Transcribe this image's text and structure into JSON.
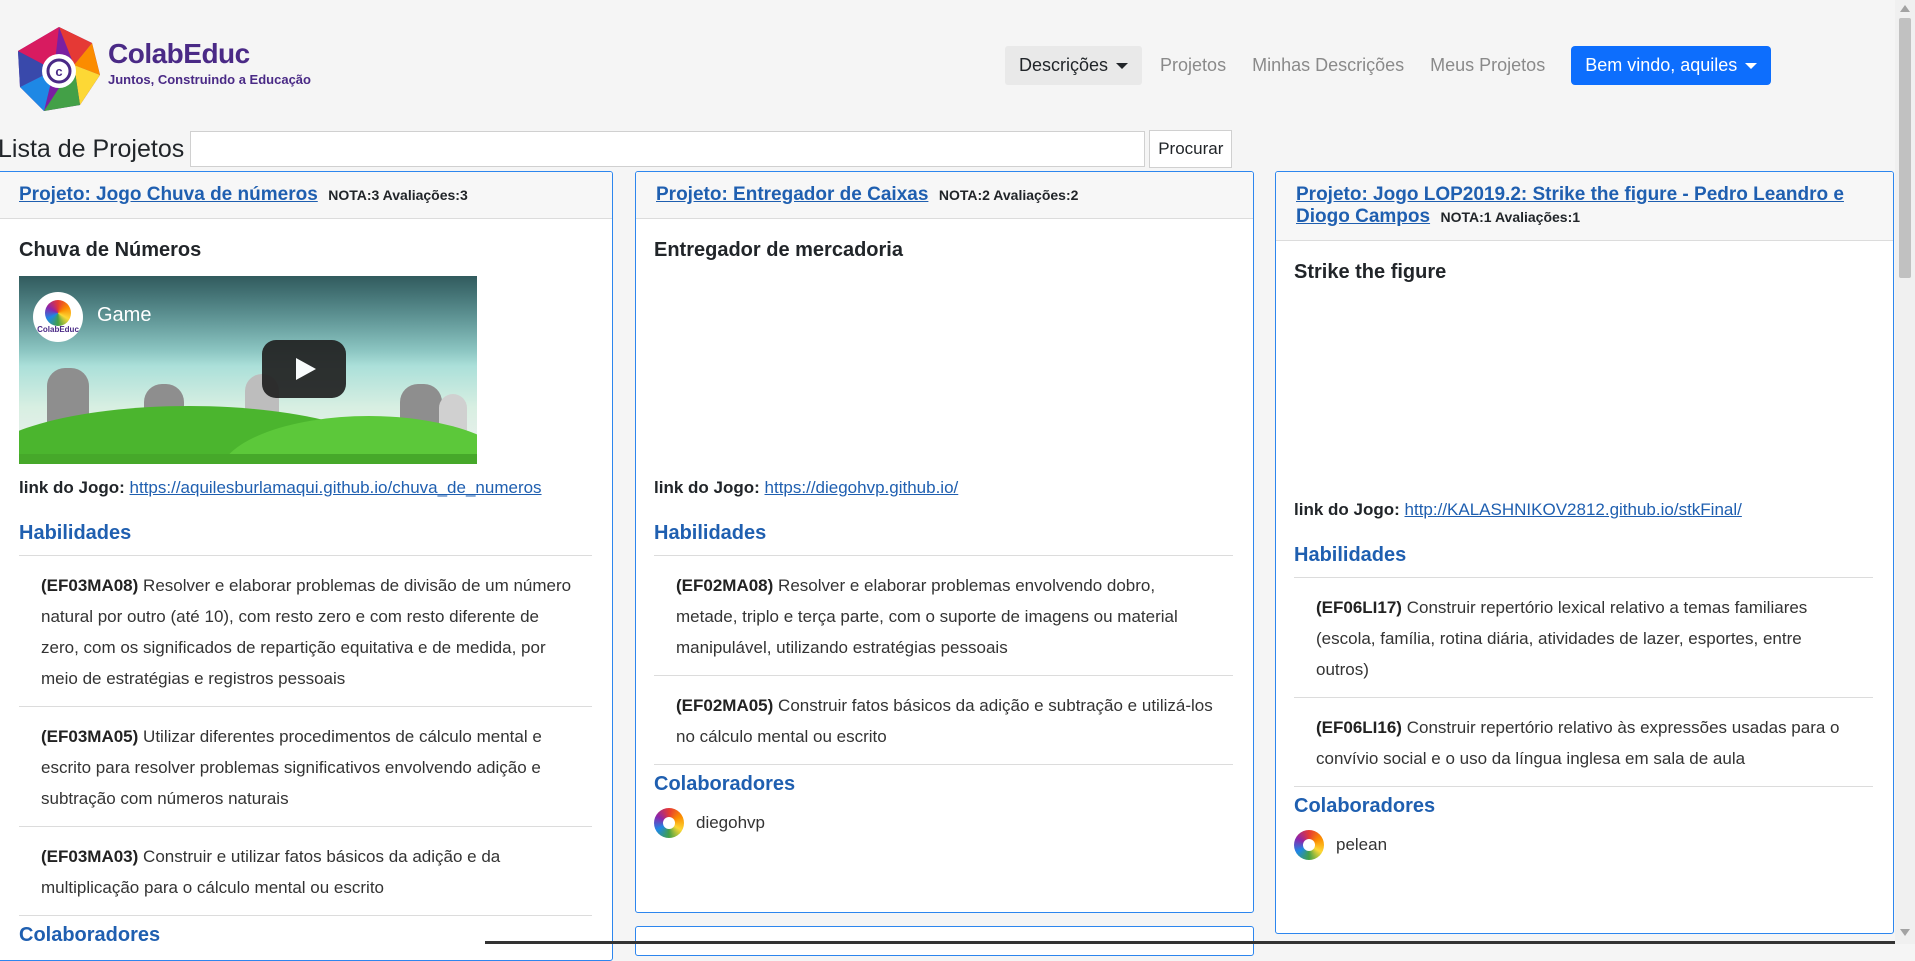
{
  "brand": {
    "name": "ColabEduc",
    "tagline": "Juntos, Construindo a Educação"
  },
  "nav": {
    "descricoes": "Descrições",
    "projetos": "Projetos",
    "minhas_descricoes": "Minhas Descrições",
    "meus_projetos": "Meus Projetos",
    "user_menu": "Bem vindo, aquiles"
  },
  "search": {
    "label": "Lista de Projetos",
    "value": "",
    "button": "Procurar"
  },
  "cards": [
    {
      "title": "Projeto: Jogo Chuva de números",
      "nota": "NOTA:3 Avaliações:3",
      "subtitle": "Chuva de Números",
      "video_title": "Game",
      "video_channel": "ColabEduc",
      "link_label": "link do Jogo:",
      "link_url": "https://aquilesburlamaqui.github.io/chuva_de_numeros",
      "habilidades_title": "Habilidades",
      "habilidades": [
        {
          "code": "(EF03MA08)",
          "text": "Resolver e elaborar problemas de divisão de um número natural por outro (até 10), com resto zero e com resto diferente de zero, com os significados de repartição equitativa e de medida, por meio de estratégias e registros pessoais"
        },
        {
          "code": "(EF03MA05)",
          "text": "Utilizar diferentes procedimentos de cálculo mental e escrito para resolver problemas significativos envolvendo adição e subtração com números naturais"
        },
        {
          "code": "(EF03MA03)",
          "text": "Construir e utilizar fatos básicos da adição e da multiplicação para o cálculo mental ou escrito"
        }
      ],
      "colaboradores_title": "Colaboradores"
    },
    {
      "title": "Projeto: Entregador de Caixas",
      "nota": "NOTA:2 Avaliações:2",
      "subtitle": "Entregador de mercadoria",
      "link_label": "link do Jogo:",
      "link_url": "https://diegohvp.github.io/",
      "habilidades_title": "Habilidades",
      "habilidades": [
        {
          "code": "(EF02MA08)",
          "text": "Resolver e elaborar problemas envolvendo dobro, metade, triplo e terça parte, com o suporte de imagens ou material manipulável, utilizando estratégias pessoais"
        },
        {
          "code": "(EF02MA05)",
          "text": "Construir fatos básicos da adição e subtração e utilizá-los no cálculo mental ou escrito"
        }
      ],
      "colaboradores_title": "Colaboradores",
      "colaboradores": [
        "diegohvp"
      ]
    },
    {
      "title": "Projeto: Jogo LOP2019.2: Strike the figure - Pedro Leandro e Diogo Campos",
      "nota": "NOTA:1 Avaliações:1",
      "subtitle": "Strike the figure",
      "link_label": "link do Jogo:",
      "link_url": "http://KALASHNIKOV2812.github.io/stkFinal/",
      "habilidades_title": "Habilidades",
      "habilidades": [
        {
          "code": "(EF06LI17)",
          "text": "Construir repertório lexical relativo a temas familiares (escola, família, rotina diária, atividades de lazer, esportes, entre outros)"
        },
        {
          "code": "(EF06LI16)",
          "text": "Construir repertório relativo às expressões usadas para o convívio social e o uso da língua inglesa em sala de aula"
        }
      ],
      "colaboradores_title": "Colaboradores",
      "colaboradores": [
        "pelean"
      ]
    }
  ]
}
